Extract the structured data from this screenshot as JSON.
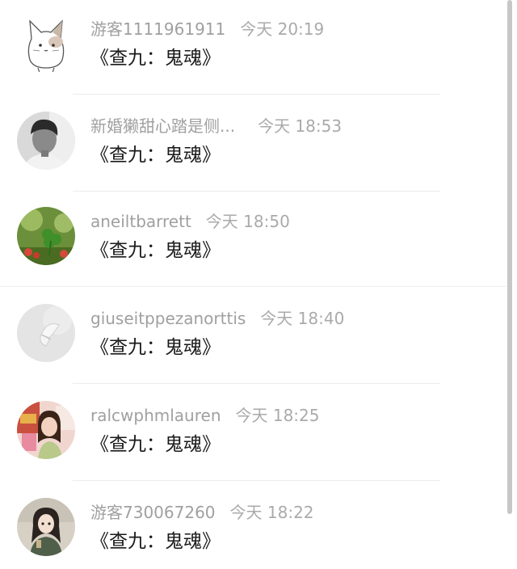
{
  "comments": [
    {
      "username": "游客1111961911",
      "time": "今天 20:19",
      "text": "《查九：鬼魂》",
      "avatar_icon": "cat-avatar-icon"
    },
    {
      "username": "新婚獭甜心踏是侧...",
      "time": "今天 18:53",
      "text": "《查九：鬼魂》",
      "avatar_icon": "boy-photo-avatar-icon"
    },
    {
      "username": "aneiltbarrett",
      "time": "今天 18:50",
      "text": "《查九：鬼魂》",
      "avatar_icon": "clover-photo-avatar-icon"
    },
    {
      "username": "giuseitppezanorttis",
      "time": "今天 18:40",
      "text": "《查九：鬼魂》",
      "avatar_icon": "butterfly-avatar-icon"
    },
    {
      "username": "ralcwphmlauren",
      "time": "今天 18:25",
      "text": "《查九：鬼魂》",
      "avatar_icon": "girl-photo-avatar-icon"
    },
    {
      "username": "游客730067260",
      "time": "今天 18:22",
      "text": "《查九：鬼魂》",
      "avatar_icon": "anime-girl-avatar-icon"
    }
  ],
  "colors": {
    "username": "#a0a0a0",
    "time": "#aaaaaa",
    "comment_text": "#1a1a1a",
    "divider": "#ececec",
    "scrollbar": "#c7c7c7"
  }
}
